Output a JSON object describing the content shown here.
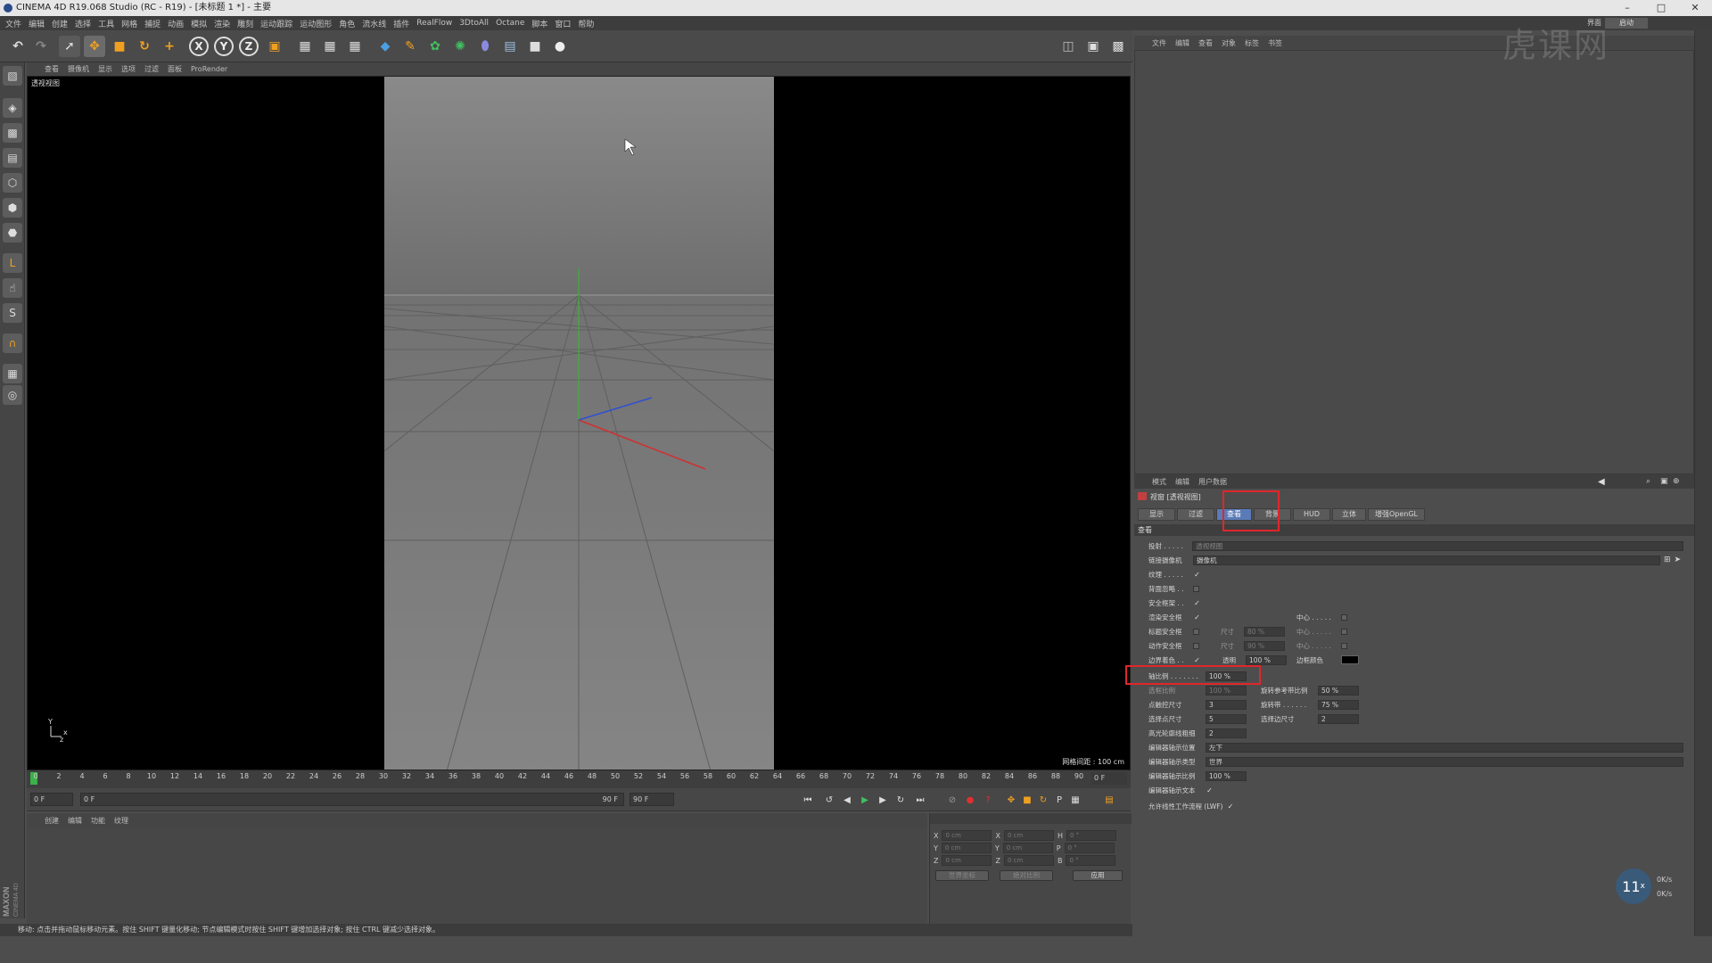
{
  "window": {
    "title": "CINEMA 4D R19.068 Studio (RC - R19) - [未标题 1 *] - 主要"
  },
  "menubar": [
    "文件",
    "编辑",
    "创建",
    "选择",
    "工具",
    "网格",
    "捕捉",
    "动画",
    "模拟",
    "渲染",
    "雕刻",
    "运动跟踪",
    "运动图形",
    "角色",
    "流水线",
    "插件",
    "RealFlow",
    "3DtoAll",
    "Octane",
    "脚本",
    "窗口",
    "帮助"
  ],
  "layout_badge": "界面",
  "layout_value": "启动",
  "viewport_menu": [
    "查看",
    "摄像机",
    "显示",
    "选项",
    "过滤",
    "面板",
    "ProRender"
  ],
  "viewport": {
    "label": "透视视图",
    "grid_spacing": "网格间距 : 100 cm"
  },
  "timeline_ticks": [
    "0",
    "2",
    "4",
    "6",
    "8",
    "10",
    "12",
    "14",
    "16",
    "18",
    "20",
    "22",
    "24",
    "26",
    "28",
    "30",
    "32",
    "34",
    "36",
    "38",
    "40",
    "42",
    "44",
    "46",
    "48",
    "50",
    "52",
    "54",
    "56",
    "58",
    "60",
    "62",
    "64",
    "66",
    "68",
    "70",
    "72",
    "74",
    "76",
    "78",
    "80",
    "82",
    "84",
    "86",
    "88",
    "90"
  ],
  "timeline_end": "0 F",
  "transport": {
    "start": "0 F",
    "current": "0 F",
    "end_small": "90 F",
    "end": "90 F"
  },
  "material_menu": [
    "创建",
    "编辑",
    "功能",
    "纹理"
  ],
  "coords": {
    "rows": [
      {
        "a": "X",
        "av": "0 cm",
        "b": "X",
        "bv": "0 cm",
        "c": "H",
        "cv": "0 °"
      },
      {
        "a": "Y",
        "av": "0 cm",
        "b": "Y",
        "bv": "0 cm",
        "c": "P",
        "cv": "0 °"
      },
      {
        "a": "Z",
        "av": "0 cm",
        "b": "Z",
        "bv": "0 cm",
        "c": "B",
        "cv": "0 °"
      }
    ],
    "dropdown1": "世界坐标",
    "dropdown2": "绝对比例",
    "apply": "应用"
  },
  "status": "移动: 点击并拖动鼠标移动元素。按住 SHIFT 键量化移动; 节点编辑模式时按住 SHIFT 键增加选择对象; 按住 CTRL 键减少选择对象。",
  "right_menu": [
    "文件",
    "编辑",
    "查看",
    "对象",
    "标签",
    "书签"
  ],
  "attr_menu": [
    "模式",
    "编辑",
    "用户数据"
  ],
  "attr": {
    "title": "视窗 [透视视图]",
    "tabs": [
      "显示",
      "过滤",
      "查看",
      "背景",
      "HUD",
      "立体",
      "增强OpenGL"
    ],
    "active_tab": 2,
    "section": "查看",
    "rows": {
      "projection_label": "投射 . . . . .",
      "projection_value": "透视视图",
      "linked_camera_label": "链接摄像机",
      "linked_camera_value": "摄像机",
      "texture_label": "纹理 . . . . .",
      "backface_label": "背面忽略 . .",
      "safe_frame_label": "安全框架 . .",
      "render_safe_label": "渲染安全框",
      "title_safe_label": "标题安全框",
      "action_safe_label": "动作安全框",
      "border_color_label": "边界着色 . .",
      "size_label": "尺寸",
      "size_title_value": "80 %",
      "size_action_value": "90 %",
      "center_label": "中心 . . . . .",
      "opacity_label": "透明",
      "opacity_value": "100 %",
      "border_color2_label": "边框颜色",
      "axis_scale_label": "轴比例 . . . . . . .",
      "axis_scale_value": "100 %",
      "extra_scale_label": "选框比例",
      "extra_scale_value": "100 %",
      "rot_ref_label": "旋转参考带比例",
      "rot_ref_value": "50 %",
      "point_size_label": "点触控尺寸",
      "point_size_value": "3",
      "rot_band_label": "旋转带 . . . . . .",
      "rot_band_value": "75 %",
      "sel_point_label": "选择点尺寸",
      "sel_point_value": "5",
      "sel_edge_label": "选择边尺寸",
      "sel_edge_value": "2",
      "hl_width_label": "高光轮廓线粗细",
      "hl_width_value": "2",
      "hud_pos_label": "编辑器轴示位置",
      "hud_pos_value": "左下",
      "hud_type_label": "编辑器轴示类型",
      "hud_type_value": "世界",
      "hud_scale_label": "编辑器轴示比例",
      "hud_scale_value": "100 %",
      "hud_text_label": "编辑器轴示文本",
      "lwf_label": "允许线性工作流程 (LWF)"
    }
  },
  "fps": {
    "value": "11",
    "unit": "x",
    "up": "0K/s",
    "down": "0K/s"
  },
  "watermark": "虎课网"
}
